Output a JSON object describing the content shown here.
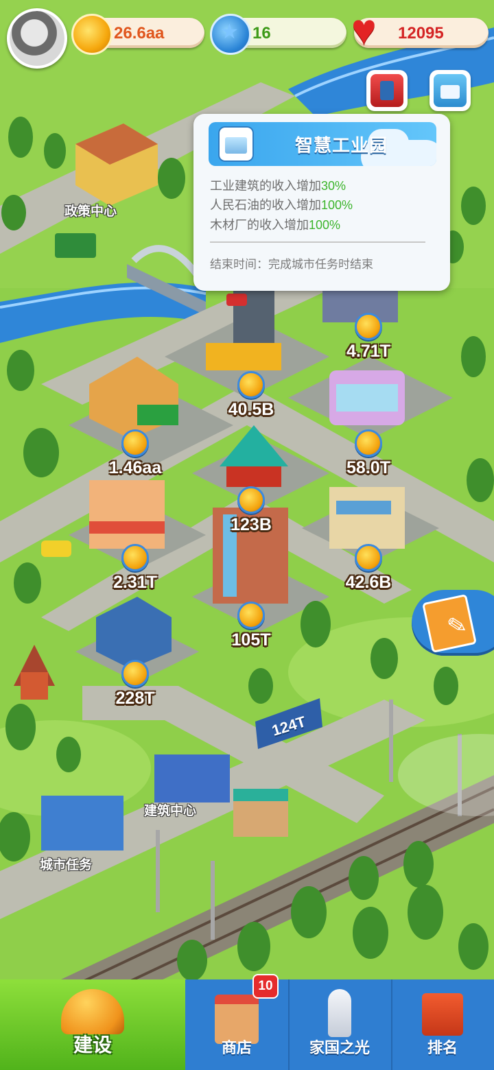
{
  "resources": {
    "gold": "26.6aa",
    "stars": "16",
    "hearts": "12095"
  },
  "popup": {
    "title": "智慧工业园",
    "lines": [
      {
        "text": "工业建筑的收入增加",
        "pct": "30%"
      },
      {
        "text": "人民石油的收入增加",
        "pct": "100%"
      },
      {
        "text": "木材厂的收入增加",
        "pct": "100%"
      }
    ],
    "end_time": "结束时间：完成城市任务时结束"
  },
  "map_labels": {
    "policy_center": "政策中心",
    "building_center": "建筑中心",
    "city_tasks": "城市任务"
  },
  "buildings": [
    {
      "income": "4.71T"
    },
    {
      "income": "40.5B"
    },
    {
      "income": "1.46aa"
    },
    {
      "income": "58.0T"
    },
    {
      "income": "123B"
    },
    {
      "income": "2.31T"
    },
    {
      "income": "42.6B"
    },
    {
      "income": "105T"
    },
    {
      "income": "228T"
    }
  ],
  "billboard": "124T",
  "nav": {
    "build": "建设",
    "shop": "商店",
    "shop_badge": "10",
    "home": "家国之光",
    "rank": "排名"
  },
  "colors": {
    "grass": "#8fcf4a",
    "river": "#2f86d8",
    "road": "#b9b9ad",
    "nav_blue": "#2f7ed1",
    "nav_green": "#6fc82a",
    "bonus_green": "#3bb42a"
  }
}
